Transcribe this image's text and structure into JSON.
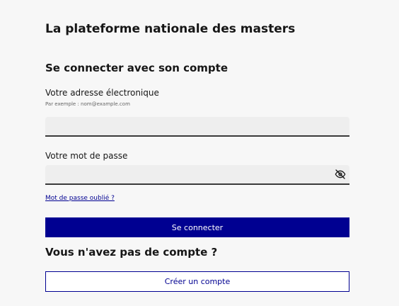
{
  "header": {
    "site_title": "La plateforme nationale des masters"
  },
  "login": {
    "title": "Se connecter avec son compte",
    "email_label": "Votre adresse électronique",
    "email_hint": "Par exemple : nom@example.com",
    "email_value": "",
    "password_label": "Votre mot de passe",
    "password_value": "",
    "password_toggle_icon": "eye-slash-icon",
    "forgot_password_link": "Mot de passe oublié ?",
    "submit_label": "Se connecter"
  },
  "signup": {
    "title": "Vous n'avez pas de compte ?",
    "create_account_label": "Créer un compte"
  },
  "colors": {
    "primary": "#000091",
    "background": "#f7f7f7",
    "input_background": "#eeeeee"
  }
}
